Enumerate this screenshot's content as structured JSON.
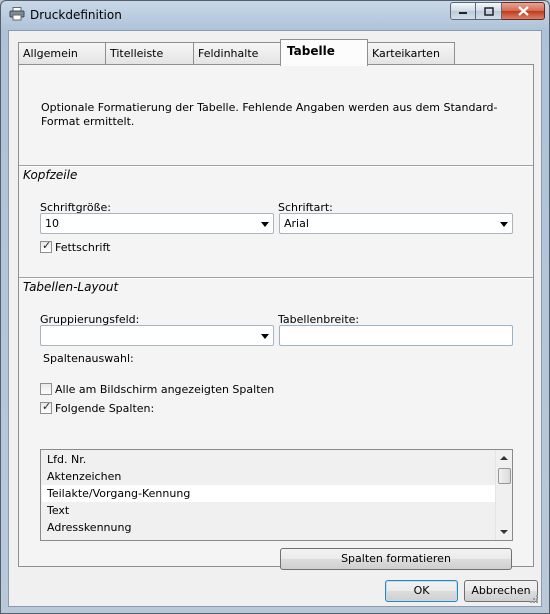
{
  "window": {
    "title": "Druckdefinition"
  },
  "tabs": [
    {
      "label": "Allgemein",
      "active": false
    },
    {
      "label": "Titelleiste",
      "active": false
    },
    {
      "label": "Feldinhalte",
      "active": false
    },
    {
      "label": "Tabelle",
      "active": true
    },
    {
      "label": "Karteikarten",
      "active": false
    }
  ],
  "intro_text": "Optionale Formatierung der Tabelle. Fehlende Angaben werden aus dem Standard-Format ermittelt.",
  "kopfzeile": {
    "title": "Kopfzeile",
    "font_size_label": "Schriftgröße:",
    "font_size_value": "10",
    "font_label": "Schriftart:",
    "font_value": "Arial",
    "bold_label": "Fettschrift",
    "bold_checked": true
  },
  "layout": {
    "title": "Tabellen-Layout",
    "grouping_label": "Gruppierungsfeld:",
    "grouping_value": "",
    "table_width_label": "Tabellenbreite:",
    "table_width_value": "",
    "column_selection_label": "Spaltenauswahl:",
    "all_columns_label": "Alle am Bildschirm angezeigten Spalten",
    "all_columns_checked": false,
    "following_columns_label": "Folgende Spalten:",
    "following_columns_checked": true,
    "columns": [
      "Lfd. Nr.",
      "Aktenzeichen",
      "Teilakte/Vorgang-Kennung",
      "Text",
      "Adresskennung"
    ],
    "selected_column_index": 2,
    "format_button_label": "Spalten formatieren"
  },
  "buttons": {
    "ok": "OK",
    "cancel": "Abbrechen"
  }
}
